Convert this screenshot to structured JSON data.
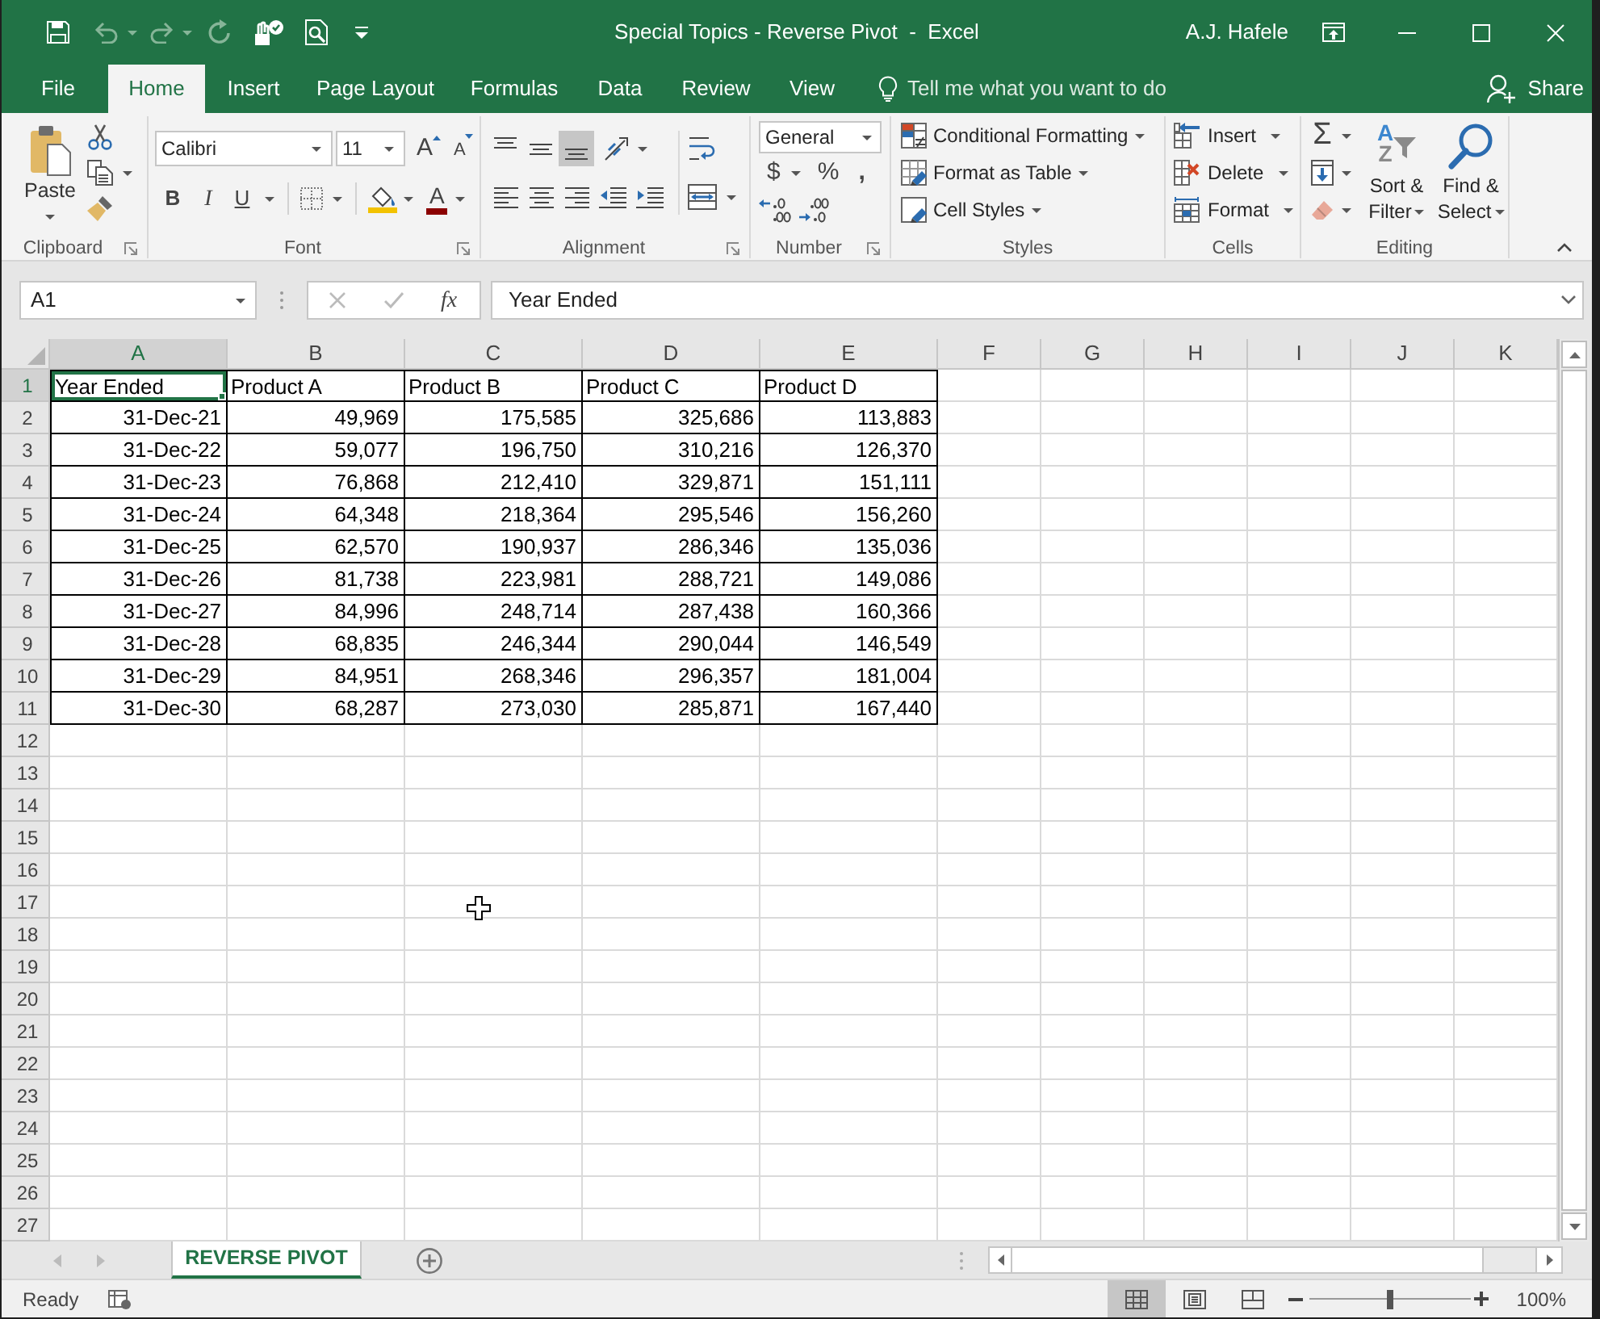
{
  "window": {
    "title": "Special Topics - Reverse Pivot  -  Excel",
    "user": "A.J. Hafele"
  },
  "quick_access": [
    {
      "kind": "save",
      "disabled": false
    },
    {
      "kind": "undo",
      "disabled": true
    },
    {
      "kind": "redo",
      "disabled": true
    },
    {
      "kind": "repeat",
      "disabled": true
    },
    {
      "kind": "touch",
      "disabled": false
    },
    {
      "kind": "preview",
      "disabled": false
    },
    {
      "kind": "customize",
      "disabled": false
    }
  ],
  "ribbon_tabs": [
    {
      "label": "File",
      "selected": false
    },
    {
      "label": "Home",
      "selected": true
    },
    {
      "label": "Insert",
      "selected": false
    },
    {
      "label": "Page Layout",
      "selected": false
    },
    {
      "label": "Formulas",
      "selected": false
    },
    {
      "label": "Data",
      "selected": false
    },
    {
      "label": "Review",
      "selected": false
    },
    {
      "label": "View",
      "selected": false
    }
  ],
  "tell_me": {
    "placeholder": "Tell me what you want to do"
  },
  "share": {
    "label": "Share"
  },
  "clipboard": {
    "paste": "Paste",
    "label": "Clipboard"
  },
  "font": {
    "name": "Calibri",
    "size": "11",
    "grow": "A",
    "shrink": "A",
    "bold": "B",
    "italic": "I",
    "underline": "U",
    "color_letter": "A",
    "label": "Font"
  },
  "alignment": {
    "vertical": [
      {
        "kind": "top",
        "selected": false
      },
      {
        "kind": "middle",
        "selected": false
      },
      {
        "kind": "bottom",
        "selected": true
      }
    ],
    "label": "Alignment"
  },
  "number": {
    "format": "General",
    "currency": "$",
    "percent": "%",
    "comma": ",",
    "label": "Number"
  },
  "styles": {
    "items": [
      "Conditional Formatting",
      "Format as Table",
      "Cell Styles"
    ],
    "label": "Styles"
  },
  "cells": {
    "items": [
      "Insert",
      "Delete",
      "Format"
    ],
    "label": "Cells"
  },
  "editing": {
    "autosum": "Σ",
    "sort_letters": [
      "A",
      "Z"
    ],
    "sort": "Sort & Filter",
    "find": "Find & Select",
    "label": "Editing"
  },
  "formula_bar": {
    "name_box": "A1",
    "function_label": "fx",
    "value": "Year Ended"
  },
  "columns": [
    {
      "label": "A",
      "selected": true
    },
    {
      "label": "B",
      "selected": false
    },
    {
      "label": "C",
      "selected": false
    },
    {
      "label": "D",
      "selected": false
    },
    {
      "label": "E",
      "selected": false
    },
    {
      "label": "F",
      "selected": false
    },
    {
      "label": "G",
      "selected": false
    },
    {
      "label": "H",
      "selected": false
    },
    {
      "label": "I",
      "selected": false
    },
    {
      "label": "J",
      "selected": false
    },
    {
      "label": "K",
      "selected": false
    }
  ],
  "row_numbers": [
    {
      "label": "1",
      "selected": true
    },
    {
      "label": "2",
      "selected": false
    },
    {
      "label": "3",
      "selected": false
    },
    {
      "label": "4",
      "selected": false
    },
    {
      "label": "5",
      "selected": false
    },
    {
      "label": "6",
      "selected": false
    },
    {
      "label": "7",
      "selected": false
    },
    {
      "label": "8",
      "selected": false
    },
    {
      "label": "9",
      "selected": false
    },
    {
      "label": "10",
      "selected": false
    },
    {
      "label": "11",
      "selected": false
    },
    {
      "label": "12",
      "selected": false
    },
    {
      "label": "13",
      "selected": false
    },
    {
      "label": "14",
      "selected": false
    },
    {
      "label": "15",
      "selected": false
    },
    {
      "label": "16",
      "selected": false
    },
    {
      "label": "17",
      "selected": false
    },
    {
      "label": "18",
      "selected": false
    },
    {
      "label": "19",
      "selected": false
    },
    {
      "label": "20",
      "selected": false
    },
    {
      "label": "21",
      "selected": false
    },
    {
      "label": "22",
      "selected": false
    },
    {
      "label": "23",
      "selected": false
    },
    {
      "label": "24",
      "selected": false
    },
    {
      "label": "25",
      "selected": false
    },
    {
      "label": "26",
      "selected": false
    },
    {
      "label": "27",
      "selected": false
    }
  ],
  "table": {
    "header": [
      {
        "text": "Year Ended",
        "selected": true
      },
      {
        "text": "Product A",
        "selected": false
      },
      {
        "text": "Product B",
        "selected": false
      },
      {
        "text": "Product C",
        "selected": false
      },
      {
        "text": "Product D",
        "selected": false
      }
    ],
    "rows": [
      [
        "31-Dec-21",
        "49,969",
        "175,585",
        "325,686",
        "113,883"
      ],
      [
        "31-Dec-22",
        "59,077",
        "196,750",
        "310,216",
        "126,370"
      ],
      [
        "31-Dec-23",
        "76,868",
        "212,410",
        "329,871",
        "151,111"
      ],
      [
        "31-Dec-24",
        "64,348",
        "218,364",
        "295,546",
        "156,260"
      ],
      [
        "31-Dec-25",
        "62,570",
        "190,937",
        "286,346",
        "135,036"
      ],
      [
        "31-Dec-26",
        "81,738",
        "223,981",
        "288,721",
        "149,086"
      ],
      [
        "31-Dec-27",
        "84,996",
        "248,714",
        "287,438",
        "160,366"
      ],
      [
        "31-Dec-28",
        "68,835",
        "246,344",
        "290,044",
        "146,549"
      ],
      [
        "31-Dec-29",
        "84,951",
        "268,346",
        "296,357",
        "181,004"
      ],
      [
        "31-Dec-30",
        "68,287",
        "273,030",
        "285,871",
        "167,440"
      ]
    ]
  },
  "sheet_tabs": [
    {
      "label": "REVERSE PIVOT",
      "selected": true
    }
  ],
  "status_bar": {
    "status": "Ready",
    "views": [
      {
        "kind": "normal",
        "selected": true
      },
      {
        "kind": "page_layout",
        "selected": false
      },
      {
        "kind": "page_break",
        "selected": false
      }
    ],
    "zoom": {
      "level": 0.5,
      "label": "100%"
    }
  }
}
